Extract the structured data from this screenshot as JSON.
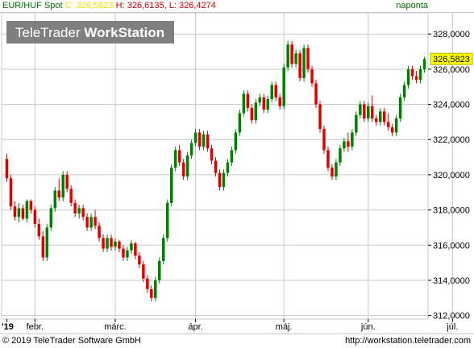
{
  "header": {
    "symbol": "EUR/HUF Spot",
    "close_prefix": "C:",
    "close_value": "326,5823",
    "high_label": "H: 326,6135",
    "low_label": "L: 326,4274",
    "period": "naponta"
  },
  "logo": {
    "text_light": "TeleTrader",
    "text_bold": "WorkStation"
  },
  "footer": {
    "copyright": "© 2019 TeleTrader Software GmbH",
    "url": "http://workstation.teletrader.com"
  },
  "colors": {
    "up": "#008000",
    "down": "#e00000",
    "grid": "#c8c8c8",
    "last_label_bg": "#ffff00",
    "logo_bg": "#7f7f7f"
  },
  "chart_data": {
    "type": "candlestick",
    "title": "EUR/HUF Spot",
    "ylim": [
      311.8,
      329.2
    ],
    "y_ticks": [
      "312,0000",
      "314,0000",
      "316,0000",
      "318,0000",
      "320,0000",
      "322,0000",
      "324,0000",
      "326,0000",
      "328,0000"
    ],
    "y_tick_values": [
      312,
      314,
      316,
      318,
      320,
      322,
      324,
      326,
      328
    ],
    "x_ticks": [
      "'19",
      "febr.",
      "márc.",
      "ápr.",
      "máj.",
      "jún.",
      "júl."
    ],
    "x_tick_index": [
      0,
      7,
      27,
      47,
      69,
      90,
      111
    ],
    "last_value": "326,5823",
    "last_value_num": 326.58,
    "grid": true,
    "ohlc": [
      [
        320.9,
        321.2,
        319.6,
        319.8
      ],
      [
        319.8,
        320.0,
        318.0,
        318.2
      ],
      [
        318.2,
        318.5,
        317.4,
        317.6
      ],
      [
        317.6,
        318.4,
        317.3,
        318.1
      ],
      [
        318.1,
        318.3,
        317.4,
        317.5
      ],
      [
        317.5,
        318.6,
        317.3,
        318.5
      ],
      [
        318.5,
        318.6,
        317.8,
        318.0
      ],
      [
        318.0,
        318.2,
        317.0,
        317.2
      ],
      [
        317.2,
        317.5,
        316.3,
        316.5
      ],
      [
        316.5,
        316.8,
        315.1,
        315.3
      ],
      [
        315.3,
        317.2,
        315.1,
        317.0
      ],
      [
        317.0,
        318.3,
        316.8,
        318.1
      ],
      [
        318.1,
        319.3,
        317.9,
        319.1
      ],
      [
        319.1,
        319.8,
        318.5,
        318.7
      ],
      [
        318.7,
        320.2,
        318.5,
        320.0
      ],
      [
        320.0,
        320.2,
        319.0,
        319.2
      ],
      [
        319.2,
        319.4,
        318.2,
        318.4
      ],
      [
        318.4,
        318.6,
        317.6,
        317.8
      ],
      [
        317.8,
        318.3,
        317.5,
        318.1
      ],
      [
        318.1,
        318.3,
        317.4,
        317.6
      ],
      [
        317.6,
        317.8,
        316.8,
        317.0
      ],
      [
        317.0,
        317.8,
        316.8,
        317.6
      ],
      [
        317.6,
        318.0,
        316.9,
        317.1
      ],
      [
        317.1,
        317.3,
        316.2,
        316.4
      ],
      [
        316.4,
        316.6,
        315.6,
        315.8
      ],
      [
        315.8,
        316.6,
        315.6,
        316.4
      ],
      [
        316.4,
        316.6,
        315.7,
        315.9
      ],
      [
        315.9,
        316.4,
        315.7,
        316.2
      ],
      [
        316.2,
        316.3,
        315.6,
        315.8
      ],
      [
        315.8,
        316.0,
        315.1,
        315.3
      ],
      [
        315.3,
        315.9,
        315.1,
        315.7
      ],
      [
        315.7,
        316.3,
        315.5,
        316.1
      ],
      [
        316.1,
        316.2,
        315.2,
        315.4
      ],
      [
        315.4,
        315.6,
        314.7,
        314.9
      ],
      [
        314.9,
        315.1,
        313.9,
        314.1
      ],
      [
        314.1,
        314.3,
        313.3,
        313.5
      ],
      [
        313.5,
        313.7,
        312.8,
        313.0
      ],
      [
        313.0,
        314.2,
        312.8,
        314.0
      ],
      [
        314.0,
        315.3,
        313.8,
        315.1
      ],
      [
        315.1,
        316.6,
        314.9,
        316.4
      ],
      [
        316.4,
        318.6,
        316.2,
        318.4
      ],
      [
        318.4,
        320.6,
        318.2,
        320.4
      ],
      [
        320.4,
        321.6,
        320.2,
        321.4
      ],
      [
        321.4,
        321.7,
        320.5,
        320.7
      ],
      [
        320.7,
        320.9,
        319.7,
        319.9
      ],
      [
        319.9,
        321.3,
        319.7,
        321.1
      ],
      [
        321.1,
        322.0,
        320.9,
        321.8
      ],
      [
        321.8,
        322.6,
        321.6,
        322.4
      ],
      [
        322.4,
        322.6,
        321.4,
        321.6
      ],
      [
        321.6,
        322.5,
        321.4,
        322.3
      ],
      [
        322.3,
        322.5,
        321.3,
        321.5
      ],
      [
        321.5,
        321.7,
        320.6,
        320.8
      ],
      [
        320.8,
        321.0,
        319.9,
        320.1
      ],
      [
        320.1,
        320.3,
        319.1,
        319.3
      ],
      [
        319.3,
        320.3,
        319.1,
        320.1
      ],
      [
        320.1,
        320.9,
        319.9,
        320.7
      ],
      [
        320.7,
        321.6,
        320.5,
        321.4
      ],
      [
        321.4,
        322.6,
        321.2,
        322.4
      ],
      [
        322.4,
        323.7,
        322.2,
        323.5
      ],
      [
        323.5,
        324.8,
        323.3,
        324.6
      ],
      [
        324.6,
        324.8,
        323.6,
        323.8
      ],
      [
        323.8,
        324.0,
        322.9,
        323.1
      ],
      [
        323.1,
        324.3,
        322.9,
        324.1
      ],
      [
        324.1,
        324.6,
        323.9,
        324.4
      ],
      [
        324.4,
        324.6,
        323.5,
        323.7
      ],
      [
        323.7,
        324.5,
        323.5,
        324.3
      ],
      [
        324.3,
        325.3,
        324.1,
        325.1
      ],
      [
        325.1,
        325.3,
        324.2,
        324.4
      ],
      [
        324.4,
        324.6,
        323.7,
        323.9
      ],
      [
        323.9,
        326.3,
        323.7,
        326.1
      ],
      [
        326.1,
        327.6,
        325.9,
        327.4
      ],
      [
        327.4,
        327.6,
        326.1,
        326.3
      ],
      [
        326.3,
        327.1,
        326.1,
        326.9
      ],
      [
        326.9,
        327.1,
        325.3,
        325.5
      ],
      [
        325.5,
        327.4,
        325.3,
        327.2
      ],
      [
        327.2,
        327.4,
        325.8,
        326.0
      ],
      [
        326.0,
        326.2,
        325.0,
        325.2
      ],
      [
        325.2,
        325.4,
        323.8,
        324.0
      ],
      [
        324.0,
        324.2,
        322.4,
        322.6
      ],
      [
        322.6,
        322.8,
        321.2,
        321.4
      ],
      [
        321.4,
        321.6,
        320.2,
        320.4
      ],
      [
        320.4,
        320.6,
        319.7,
        319.9
      ],
      [
        319.9,
        320.9,
        319.7,
        320.7
      ],
      [
        320.7,
        321.7,
        320.5,
        321.5
      ],
      [
        321.5,
        322.1,
        321.3,
        321.9
      ],
      [
        321.9,
        322.4,
        321.3,
        321.6
      ],
      [
        321.6,
        322.6,
        321.4,
        322.4
      ],
      [
        322.4,
        323.6,
        322.2,
        323.4
      ],
      [
        323.4,
        324.2,
        323.2,
        324.0
      ],
      [
        324.0,
        324.2,
        323.0,
        323.2
      ],
      [
        323.2,
        324.1,
        323.0,
        323.9
      ],
      [
        323.9,
        324.5,
        323.0,
        323.2
      ],
      [
        323.2,
        323.4,
        322.8,
        323.0
      ],
      [
        323.0,
        323.8,
        322.8,
        323.6
      ],
      [
        323.6,
        323.8,
        322.8,
        323.0
      ],
      [
        323.0,
        323.5,
        322.5,
        322.7
      ],
      [
        322.7,
        322.9,
        322.2,
        322.4
      ],
      [
        322.4,
        323.4,
        322.2,
        323.2
      ],
      [
        323.2,
        324.6,
        323.0,
        324.4
      ],
      [
        324.4,
        325.3,
        324.2,
        325.1
      ],
      [
        325.1,
        326.2,
        324.9,
        326.0
      ],
      [
        326.0,
        326.2,
        325.4,
        325.6
      ],
      [
        325.6,
        325.9,
        325.2,
        325.4
      ],
      [
        325.4,
        326.2,
        325.2,
        326.0
      ],
      [
        326.0,
        326.7,
        325.8,
        326.58
      ]
    ]
  }
}
